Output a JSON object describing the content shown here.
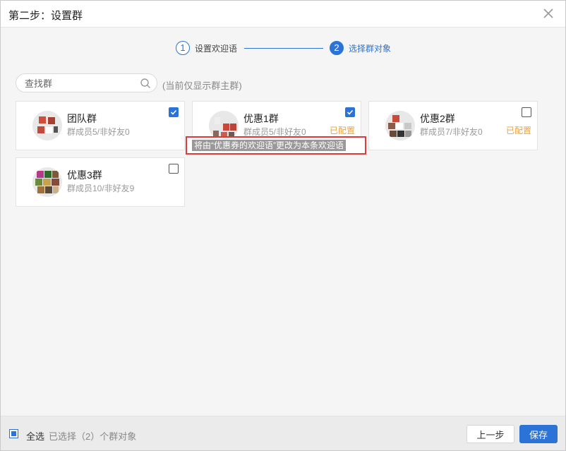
{
  "dialog": {
    "title": "第二步：设置群"
  },
  "steps": [
    {
      "number": "1",
      "label": "设置欢迎语",
      "state": "done"
    },
    {
      "number": "2",
      "label": "选择群对象",
      "state": "active"
    }
  ],
  "search": {
    "placeholder": "查找群",
    "hint": "(当前仅显示群主群)"
  },
  "groups": [
    {
      "name": "团队群",
      "meta": "群成员5/非好友0",
      "checked": true,
      "status": ""
    },
    {
      "name": "优惠1群",
      "meta": "群成员5/非好友0",
      "checked": true,
      "status": "已配置"
    },
    {
      "name": "优惠2群",
      "meta": "群成员7/非好友0",
      "checked": false,
      "status": "已配置"
    },
    {
      "name": "优惠3群",
      "meta": "群成员10/非好友9",
      "checked": false,
      "status": ""
    }
  ],
  "tooltip": {
    "text": "将由“优惠券的欢迎语”更改为本条欢迎语"
  },
  "footer": {
    "select_all_label": "全选",
    "selected_text": "已选择（2）个群对象",
    "prev_label": "上一步",
    "save_label": "保存"
  },
  "colors": {
    "accent": "#2b73d6",
    "configured": "#e8a33a",
    "highlight_border": "#e03b3b"
  }
}
